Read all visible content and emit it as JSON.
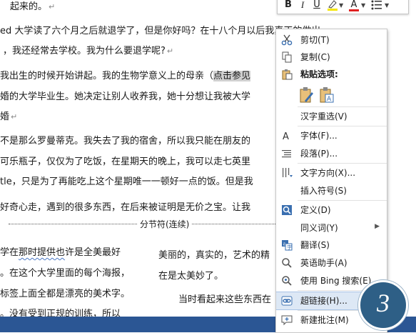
{
  "document": {
    "lines": [
      {
        "text": "起来的。"
      },
      {
        "text": "ed 大学读了六个月之后就退学了，但是你好吗？在十八个月以后我真正的做出"
      },
      {
        "text": "，我还经常去学校。我为什么要退学呢?"
      },
      {
        "text": "我出生的时候开始讲起。我的生物学意义上的母亲（",
        "selected": "点击参见"
      },
      {
        "text": "婚的大学毕业生。她决定让别人收养我，她十分想让我被大学"
      },
      {
        "text": "婚"
      },
      {
        "text": "不是那么罗曼蒂克。我失去了我的宿舍，所以我只能在朋友的"
      },
      {
        "text": "可乐瓶子，仅仅为了吃饭，在星期天的晚上，我可以走七英里"
      },
      {
        "text": "tle，只是为了再能吃上这个星期唯一一顿好一点的饭。但是我"
      },
      {
        "text": "好奇心走，遇到的很多东西，在后来被证明是无价之宝。让我"
      }
    ],
    "section_break": "分节符(连续)",
    "col_lines": [
      {
        "left": "学在那时提供也许是全美最好",
        "squiggle": "那时提供也",
        "right": "美丽的，真实的，艺术的精"
      },
      {
        "left": "。在这个大学里面的每个海报，",
        "right": "在是太美妙了。"
      },
      {
        "left": "标签上面全都是漂亮的美术字。",
        "right": "当时看起来这些东西在"
      },
      {
        "left": "。没有受到正规的训练，所以"
      }
    ]
  },
  "mini_toolbar": {
    "buttons": [
      {
        "label": "B"
      },
      {
        "label": "I"
      },
      {
        "label": "U"
      },
      {
        "label": "A"
      }
    ]
  },
  "context_menu": {
    "items": [
      {
        "label": "剪切(T)",
        "icon": "scissors-icon"
      },
      {
        "label": "复制(C)",
        "icon": "copy-icon"
      },
      {
        "label": "粘贴选项:",
        "icon": "clipboard-icon"
      },
      {
        "label": "汉字重选(V)",
        "icon": ""
      },
      {
        "label": "字体(F)...",
        "icon": "font-icon"
      },
      {
        "label": "段落(P)...",
        "icon": "paragraph-icon"
      },
      {
        "label": "文字方向(X)...",
        "icon": "text-direction-icon"
      },
      {
        "label": "插入符号(S)",
        "icon": ""
      },
      {
        "label": "定义(D)",
        "icon": "define-icon"
      },
      {
        "label": "同义词(Y)",
        "icon": ""
      },
      {
        "label": "翻译(S)",
        "icon": "translate-icon"
      },
      {
        "label": "英语助手(A)",
        "icon": "english-assistant-icon"
      },
      {
        "label": "使用 Bing 搜索(E)",
        "icon": "bing-search-icon"
      },
      {
        "label": "超链接(H)...",
        "icon": "hyperlink-icon"
      },
      {
        "label": "新建批注(M)",
        "icon": "new-comment-icon"
      }
    ]
  },
  "step_badge": {
    "number": "3"
  },
  "colors": {
    "accent": "#2e5f86",
    "highlight": "#dde8f5",
    "status_bar": "#2b5694"
  }
}
